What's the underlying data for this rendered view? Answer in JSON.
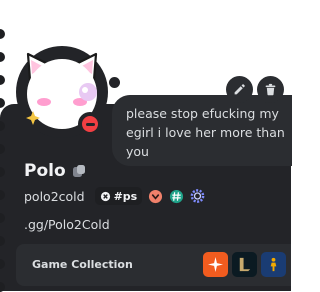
{
  "profile": {
    "display_name": "Polo",
    "username": "polo2cold",
    "guild_tag": "#ps",
    "bio": ".gg/Polo2Cold",
    "status": "do-not-disturb"
  },
  "custom_status": {
    "text": "please stop efucking my egirl i love her more than you"
  },
  "actions": {
    "edit_icon": "pencil-icon",
    "delete_icon": "trash-icon"
  },
  "badges": [
    "heart-badge",
    "hashtag-badge",
    "gear-badge"
  ],
  "game_collection": {
    "title": "Game Collection",
    "games": [
      "game-icon-orange",
      "game-icon-league",
      "game-icon-counter-strike"
    ]
  },
  "colors": {
    "card": "#232428",
    "panel": "#2b2d31",
    "dnd": "#f23f43",
    "accent_pink": "#ff9ecf"
  }
}
